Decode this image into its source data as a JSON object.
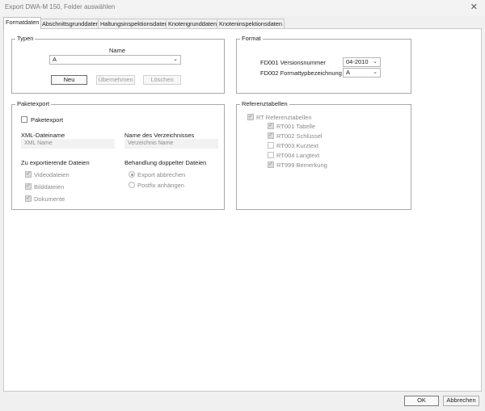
{
  "window": {
    "title": "Export DWA-M 150, Felder auswählen",
    "close_glyph": "✕"
  },
  "tabs": [
    {
      "label": "Formatdaten",
      "active": true
    },
    {
      "label": "Abschnittsgrunddaten",
      "active": false
    },
    {
      "label": "Haltungsinspektionsdaten",
      "active": false
    },
    {
      "label": "Knotengrunddaten",
      "active": false
    },
    {
      "label": "Knoteninspektionsdaten",
      "active": false
    }
  ],
  "typen": {
    "title": "Typen",
    "name_label": "Name",
    "name_value": "A",
    "btn_neu": "Neu",
    "btn_uebernehmen": "Übernehmen",
    "btn_loeschen": "Löschen"
  },
  "format": {
    "title": "Format",
    "versionsnummer_label": "FD001 Versionsnummer",
    "versionsnummer_value": "04-2010",
    "formattyp_label": "FD002 Formattypbezeichnung",
    "formattyp_value": "A"
  },
  "paketexport": {
    "title": "Paketexport",
    "checkbox_label": "Paketexport",
    "xml_label": "XML-Dateiname",
    "xml_placeholder": "XML Name",
    "dir_label": "Name des Verzeichnisses",
    "dir_placeholder": "Verzeichnis Name",
    "files_title": "Zu exportierende Dateien",
    "files": [
      "Videodateien",
      "Bilddateien",
      "Dokumente"
    ],
    "dup_title": "Behandlung doppelter Dateien",
    "dup_options": [
      "Export abbrechen",
      "Postfix anhängen"
    ]
  },
  "referenz": {
    "title": "Referenztabellen",
    "parent_label": "RT Referenztabellen",
    "items": [
      {
        "label": "RT001 Tabelle",
        "checked": true
      },
      {
        "label": "RT002 Schlüssel",
        "checked": true
      },
      {
        "label": "RT003 Kurztext",
        "checked": false
      },
      {
        "label": "RT004 Langtext",
        "checked": false
      },
      {
        "label": "RT999 Bemerkung",
        "checked": true
      }
    ]
  },
  "footer": {
    "ok": "OK",
    "cancel": "Abbrechen"
  },
  "icons": {
    "chevron": "chevron-down-icon",
    "close": "close-icon",
    "check": "check-icon"
  }
}
